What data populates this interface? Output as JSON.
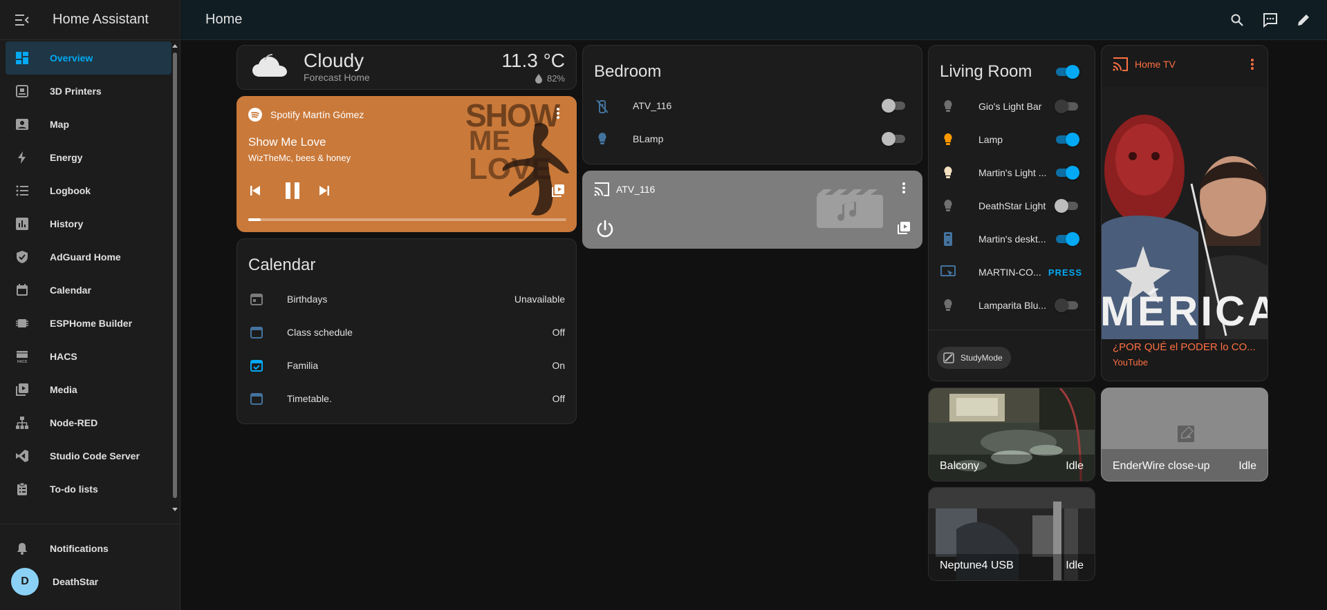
{
  "sidebar": {
    "title": "Home Assistant",
    "items": [
      {
        "label": "Overview",
        "icon": "view-dashboard-icon"
      },
      {
        "label": "3D Printers",
        "icon": "printer-3d-icon"
      },
      {
        "label": "Map",
        "icon": "map-icon"
      },
      {
        "label": "Energy",
        "icon": "lightning-bolt-icon"
      },
      {
        "label": "Logbook",
        "icon": "format-list-bulleted-icon"
      },
      {
        "label": "History",
        "icon": "chart-box-icon"
      },
      {
        "label": "AdGuard Home",
        "icon": "shield-check-icon"
      },
      {
        "label": "Calendar",
        "icon": "calendar-icon"
      },
      {
        "label": "ESPHome Builder",
        "icon": "chip-icon"
      },
      {
        "label": "HACS",
        "icon": "hacs-icon"
      },
      {
        "label": "Media",
        "icon": "play-box-multiple-icon"
      },
      {
        "label": "Node-RED",
        "icon": "sitemap-icon"
      },
      {
        "label": "Studio Code Server",
        "icon": "vscode-icon"
      },
      {
        "label": "To-do lists",
        "icon": "clipboard-list-icon"
      }
    ],
    "notifications_label": "Notifications",
    "user": {
      "name": "DeathStar",
      "initial": "D"
    }
  },
  "topbar": {
    "title": "Home"
  },
  "weather": {
    "condition": "Cloudy",
    "subtitle": "Forecast Home",
    "temperature": "11.3 °C",
    "humidity": "82%"
  },
  "spotify": {
    "source": "Spotify Martín Gómez",
    "track": "Show Me Love",
    "artist": "WizTheMc, bees & honey",
    "artwork_text": [
      "SHOW",
      "ME",
      "LOVE"
    ],
    "progress": 0.04,
    "color": "#c9793a"
  },
  "calendar": {
    "title": "Calendar",
    "rows": [
      {
        "label": "Birthdays",
        "value": "Unavailable"
      },
      {
        "label": "Class schedule",
        "value": "Off"
      },
      {
        "label": "Familia",
        "value": "On"
      },
      {
        "label": "Timetable.",
        "value": "Off"
      }
    ]
  },
  "bedroom": {
    "title": "Bedroom",
    "rows": [
      {
        "label": "ATV_116",
        "on": false
      },
      {
        "label": "BLamp",
        "on": false
      }
    ]
  },
  "atv_player": {
    "title": "ATV_116"
  },
  "living_room": {
    "title": "Living Room",
    "rows": [
      {
        "label": "Gio's Light Bar",
        "on": false
      },
      {
        "label": "Lamp",
        "on": true
      },
      {
        "label": "Martin's Light ...",
        "on": true
      },
      {
        "label": "DeathStar Light",
        "on": false
      },
      {
        "label": "Martin's deskt...",
        "on": true
      },
      {
        "label": "MARTIN-CO...",
        "action": "PRESS"
      },
      {
        "label": "Lamparita Blu...",
        "on": false
      }
    ],
    "scene_button": "StudyMode"
  },
  "home_tv": {
    "title": "Home TV",
    "artwork_text": "MÉRICA",
    "media_title": "¿POR QUÉ el PODER lo CO...",
    "app": "YouTube"
  },
  "cameras": [
    {
      "name": "Balcony",
      "state": "Idle"
    },
    {
      "name": "EnderWire close-up",
      "state": "Idle"
    },
    {
      "name": "Neptune4 USB",
      "state": "Idle"
    }
  ],
  "colors": {
    "accent": "#03a9f4",
    "lamp_on": "#ff9800",
    "tv_accent": "#ff7043"
  }
}
